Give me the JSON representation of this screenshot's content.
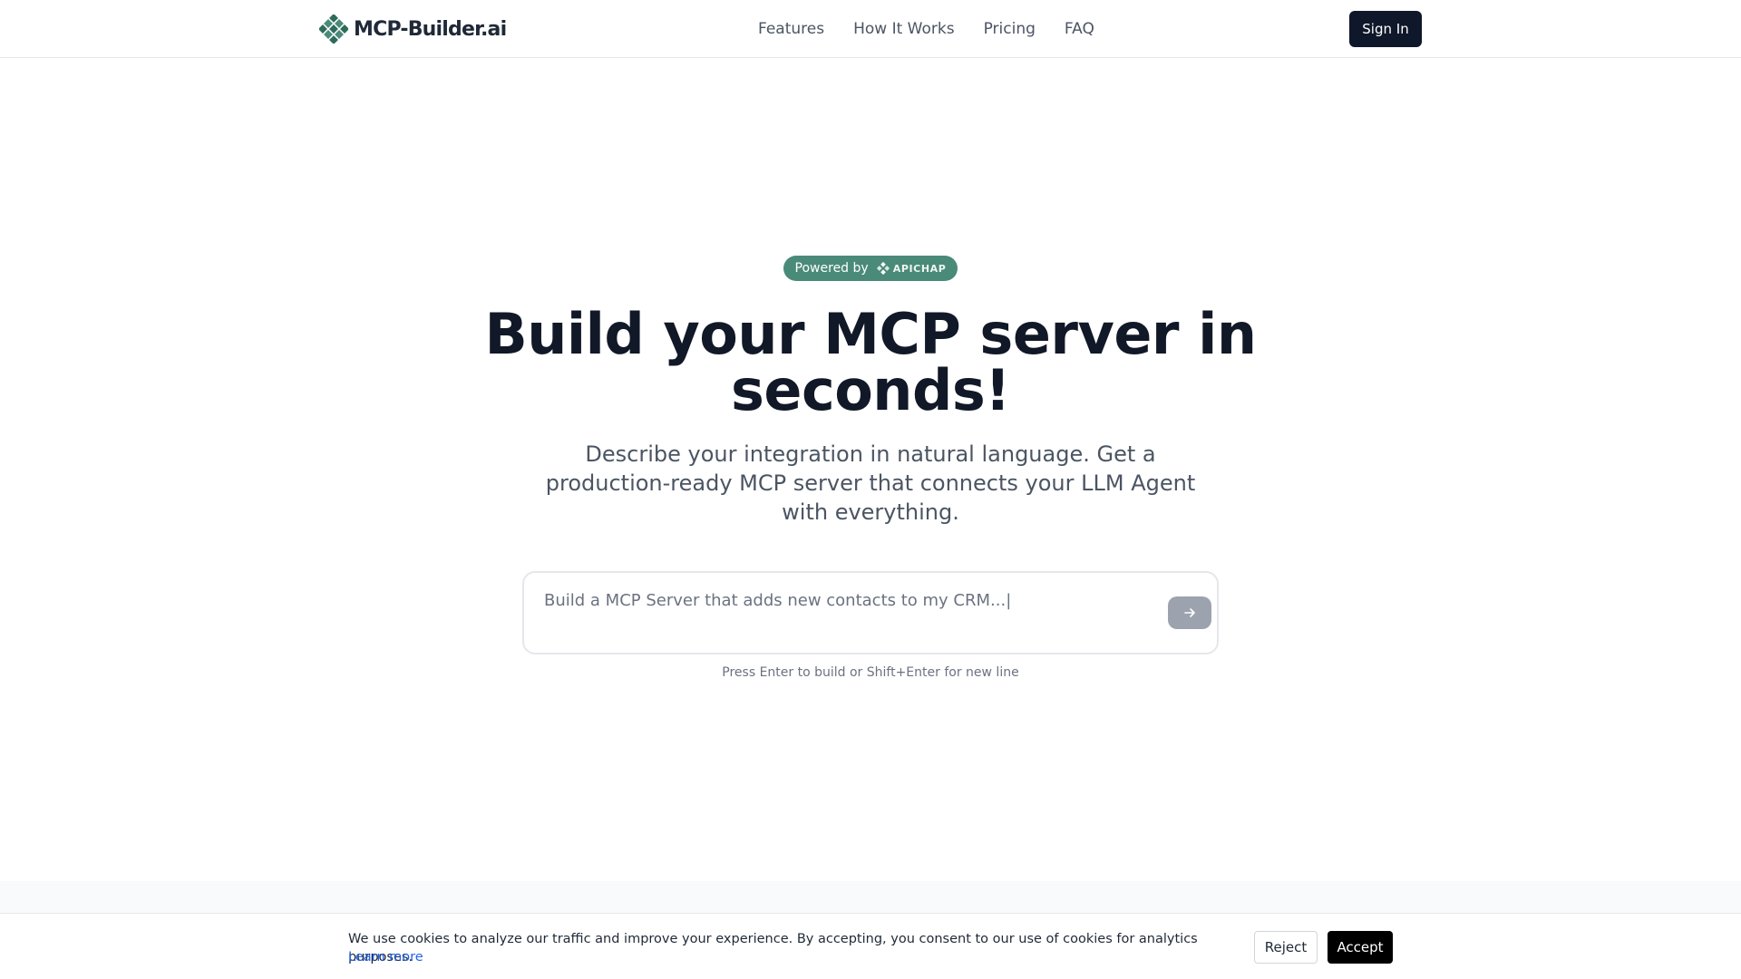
{
  "brand": {
    "name": "MCP-Builder.ai",
    "logo_icon": "diamond-grid-icon",
    "accent_color": "#4a8a78"
  },
  "nav": {
    "items": [
      {
        "label": "Features"
      },
      {
        "label": "How It Works"
      },
      {
        "label": "Pricing"
      },
      {
        "label": "FAQ"
      }
    ],
    "signin_label": "Sign In"
  },
  "hero": {
    "badge_prefix": "Powered by",
    "badge_brand": "APICHAP",
    "title": "Build your MCP server in seconds!",
    "subtitle": "Describe your integration in natural language. Get a production-ready MCP server that connects your LLM Agent with everything.",
    "prompt_placeholder": "Build a MCP Server that adds new contacts to my CRM...|",
    "send_icon": "arrow-right-icon",
    "hint": "Press Enter to build or Shift+Enter for new line"
  },
  "cookie": {
    "text": "We use cookies to analyze our traffic and improve your experience. By accepting, you consent to our use of cookies for analytics purposes.",
    "learn_more": "Learn more",
    "reject_label": "Reject",
    "accept_label": "Accept"
  }
}
